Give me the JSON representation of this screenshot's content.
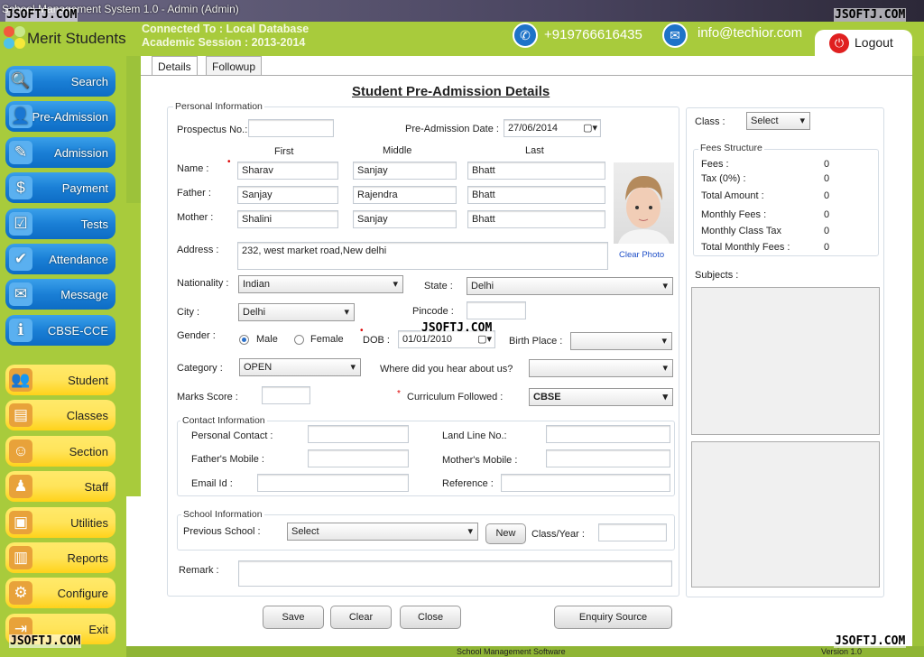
{
  "window": {
    "title": "School Management System 1.0  -  Admin (Admin)"
  },
  "watermark": "JSOFTJ.COM",
  "header": {
    "app_name": "Merit Students",
    "connected": "Connected To : Local Database",
    "session": "Academic Session : 2013-2014",
    "phone": "+919766616435",
    "email": "info@techior.com",
    "logout": "Logout",
    "brand_color": "#a8cb3c"
  },
  "sidebar": {
    "primary": [
      {
        "label": "Search",
        "icon": "search-icon"
      },
      {
        "label": "Pre-Admission",
        "icon": "student-icon"
      },
      {
        "label": "Admission",
        "icon": "form-icon"
      },
      {
        "label": "Payment",
        "icon": "money-icon"
      },
      {
        "label": "Tests",
        "icon": "checklist-icon"
      },
      {
        "label": "Attendance",
        "icon": "person-check-icon"
      },
      {
        "label": "Message",
        "icon": "mail-icon"
      },
      {
        "label": "CBSE-CCE",
        "icon": "folder-info-icon"
      }
    ],
    "secondary": [
      {
        "label": "Student",
        "icon": "students-icon"
      },
      {
        "label": "Classes",
        "icon": "document-icon"
      },
      {
        "label": "Section",
        "icon": "group-icon"
      },
      {
        "label": "Staff",
        "icon": "staff-icon"
      },
      {
        "label": "Utilities",
        "icon": "box-icon"
      },
      {
        "label": "Reports",
        "icon": "chart-icon"
      },
      {
        "label": "Configure",
        "icon": "gear-icon"
      },
      {
        "label": "Exit",
        "icon": "exit-door-icon"
      }
    ]
  },
  "tabs": [
    "Details",
    "Followup"
  ],
  "form": {
    "title": "Student Pre-Admission Details",
    "personal_legend": "Personal Information",
    "prospectus_label": "Prospectus No.:",
    "prospectus": "",
    "preadm_date_label": "Pre-Admission Date :",
    "preadm_date": "27/06/2014",
    "col_first": "First",
    "col_middle": "Middle",
    "col_last": "Last",
    "name_label": "Name :",
    "name": [
      "Sharav",
      "Sanjay",
      "Bhatt"
    ],
    "father_label": "Father :",
    "father": [
      "Sanjay",
      "Rajendra",
      "Bhatt"
    ],
    "mother_label": "Mother :",
    "mother": [
      "Shalini",
      "Sanjay",
      "Bhatt"
    ],
    "clear_photo": "Clear Photo",
    "address_label": "Address :",
    "address": "232, west market road,New delhi",
    "nationality_label": "Nationality :",
    "nationality": "Indian",
    "state_label": "State :",
    "state": "Delhi",
    "city_label": "City :",
    "city": "Delhi",
    "pincode_label": "Pincode :",
    "pincode": "",
    "gender_label": "Gender :",
    "male": "Male",
    "female": "Female",
    "dob_label": "DOB :",
    "dob": "01/01/2010",
    "birthplace_label": "Birth Place :",
    "birthplace": "",
    "category_label": "Category :",
    "category": "OPEN",
    "hear_label": "Where did you hear about us?",
    "hear": "",
    "marks_label": "Marks Score :",
    "marks": "",
    "curriculum_label": "Curriculum Followed :",
    "curriculum": "CBSE",
    "contact_legend": "Contact Information",
    "personal_contact_label": "Personal Contact :",
    "landline_label": "Land Line No.:",
    "father_mobile_label": "Father's Mobile :",
    "mother_mobile_label": "Mother's Mobile :",
    "email_label": "Email Id :",
    "reference_label": "Reference :",
    "school_legend": "School Information",
    "prev_school_label": "Previous School :",
    "prev_school": "Select",
    "new_btn": "New",
    "class_year_label": "Class/Year :",
    "remark_label": "Remark :"
  },
  "buttons": {
    "save": "Save",
    "clear": "Clear",
    "close": "Close",
    "enquiry": "Enquiry Source"
  },
  "right": {
    "class_label": "Class :",
    "class": "Select",
    "fees_legend": "Fees Structure",
    "fees": [
      {
        "label": "Fees :",
        "value": "0"
      },
      {
        "label": "Tax (0%) :",
        "value": "0"
      },
      {
        "label": "Total Amount :",
        "value": "0"
      },
      {
        "label": "Monthly Fees :",
        "value": "0"
      },
      {
        "label": "Monthly Class Tax",
        "value": "0"
      },
      {
        "label": "Total Monthly Fees :",
        "value": "0"
      }
    ],
    "subjects_label": "Subjects :"
  },
  "status": {
    "center": "School Management Software",
    "version": "Version 1.0"
  }
}
